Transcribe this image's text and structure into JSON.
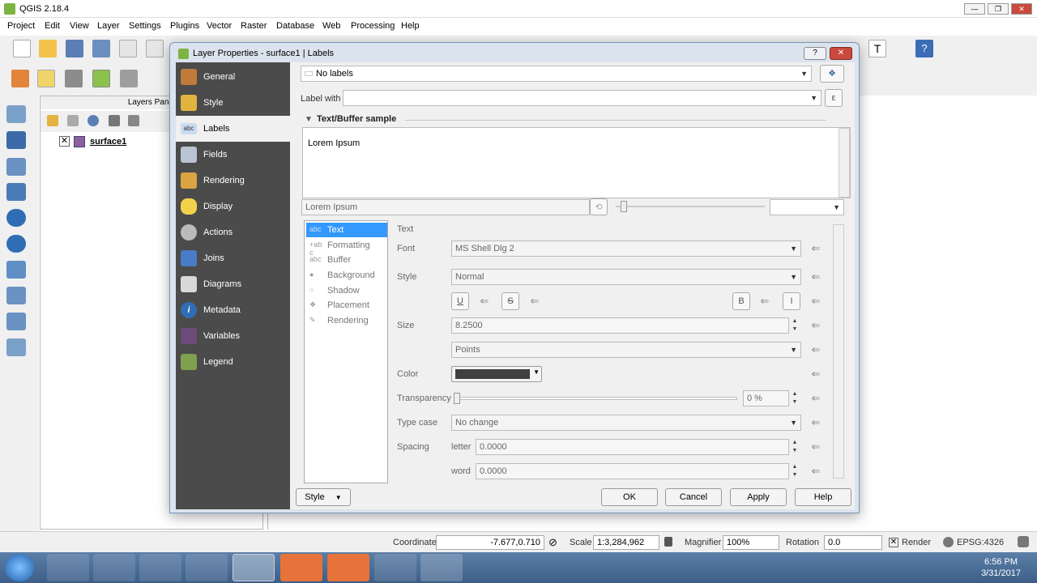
{
  "window": {
    "title": "QGIS 2.18.4"
  },
  "menu": [
    "Project",
    "Edit",
    "View",
    "Layer",
    "Settings",
    "Plugins",
    "Vector",
    "Raster",
    "Database",
    "Web",
    "Processing",
    "Help"
  ],
  "layers_panel": {
    "title": "Layers Panel",
    "layer_name": "surface1"
  },
  "dialog": {
    "title": "Layer Properties - surface1 | Labels",
    "help_btn": "?",
    "close_btn": "✕",
    "sidebar": [
      "General",
      "Style",
      "Labels",
      "Fields",
      "Rendering",
      "Display",
      "Actions",
      "Joins",
      "Diagrams",
      "Metadata",
      "Variables",
      "Legend"
    ],
    "mode": "No labels",
    "label_with_label": "Label with",
    "expr_btn": "ε",
    "section_title": "Text/Buffer sample",
    "sample_text": "Lorem Ipsum",
    "sample_input": "Lorem Ipsum",
    "tree": [
      "Text",
      "Formatting",
      "Buffer",
      "Background",
      "Shadow",
      "Placement",
      "Rendering"
    ],
    "tree_icons": [
      "abc",
      "+ab c",
      "abc",
      "●",
      "○",
      "❖",
      "✎"
    ],
    "panel_heading": "Text",
    "font_label": "Font",
    "font_value": "MS Shell Dlg 2",
    "style_label": "Style",
    "style_value": "Normal",
    "fmt_u": "U",
    "fmt_s": "S",
    "fmt_b": "B",
    "fmt_i": "I",
    "size_label": "Size",
    "size_value": "8.2500",
    "unit_value": "Points",
    "color_label": "Color",
    "color_value": "#404040",
    "transparency_label": "Transparency",
    "transparency_value": "0 %",
    "typecase_label": "Type case",
    "typecase_value": "No change",
    "spacing_label": "Spacing",
    "letter_label": "letter",
    "letter_value": "0.0000",
    "word_label": "word",
    "word_value": "0.0000",
    "style_btn": "Style",
    "ok": "OK",
    "cancel": "Cancel",
    "apply": "Apply",
    "help": "Help"
  },
  "status": {
    "coordinate_label": "Coordinate",
    "coordinate_value": "-7.677,0.710",
    "scale_label": "Scale",
    "scale_value": "1:3,284,962",
    "magnifier_label": "Magnifier",
    "magnifier_value": "100%",
    "rotation_label": "Rotation",
    "rotation_value": "0.0",
    "render_label": "Render",
    "crs": "EPSG:4326"
  },
  "taskbar": {
    "time": "6:56 PM",
    "date": "3/31/2017"
  }
}
